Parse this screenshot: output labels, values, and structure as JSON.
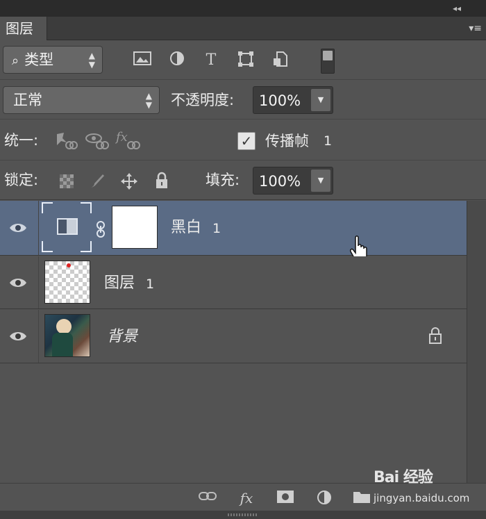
{
  "panel": {
    "tab_label": "图层",
    "collapse_glyph": "◂◂",
    "menu_glyph": "▾≡"
  },
  "filter_row": {
    "kind_select": {
      "icon": "search-icon",
      "label": "类型"
    },
    "filter_icons": [
      "pixel-layer-filter-icon",
      "adjustment-layer-filter-icon",
      "type-layer-filter-icon",
      "shape-layer-filter-icon",
      "smart-object-filter-icon"
    ],
    "type_glyph": "T"
  },
  "blend_row": {
    "blend_mode": "正常",
    "opacity_label": "不透明度:",
    "opacity_value": "100%"
  },
  "unify_row": {
    "unify_label": "统一:",
    "propagate_label": "传播帧",
    "propagate_value": "1",
    "propagate_checked": true
  },
  "lock_row": {
    "lock_label": "锁定:",
    "fill_label": "填充:",
    "fill_value": "100%"
  },
  "layers": [
    {
      "name": "黑白",
      "number": "1",
      "kind": "adjustment",
      "selected": true,
      "visible": true
    },
    {
      "name": "图层",
      "number": "1",
      "kind": "pixel",
      "selected": false,
      "visible": true
    },
    {
      "name": "背景",
      "number": "",
      "kind": "background",
      "selected": false,
      "visible": true,
      "locked": true
    }
  ],
  "bottom_bar": {
    "fx_label": "fx"
  },
  "watermark": {
    "brand": "Bai 经验",
    "url": "jingyan.baidu.com"
  },
  "colors": {
    "panel_bg": "#535353",
    "selected_layer": "#5a6b85",
    "field_bg": "#3c3c3c"
  }
}
